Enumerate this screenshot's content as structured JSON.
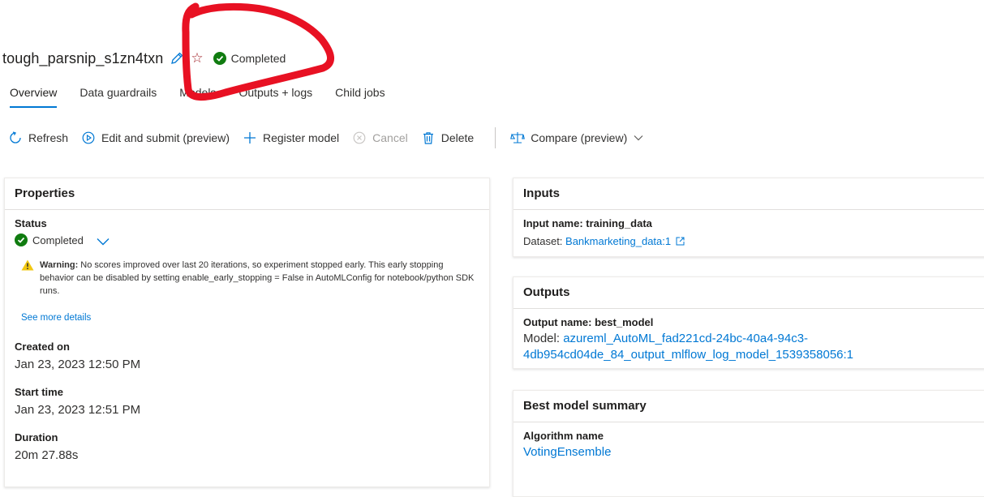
{
  "header": {
    "job_title": "tough_parsnip_s1zn4txn",
    "status": "Completed"
  },
  "tabs": [
    {
      "label": "Overview",
      "active": true
    },
    {
      "label": "Data guardrails"
    },
    {
      "label": "Models"
    },
    {
      "label": "Outputs + logs"
    },
    {
      "label": "Child jobs"
    }
  ],
  "toolbar": {
    "refresh": "Refresh",
    "edit_submit": "Edit and submit (preview)",
    "register_model": "Register model",
    "cancel": "Cancel",
    "delete": "Delete",
    "compare": "Compare (preview)"
  },
  "properties": {
    "title": "Properties",
    "status_label": "Status",
    "status_value": "Completed",
    "warning_bold": "Warning:",
    "warning_text": " No scores improved over last 20 iterations, so experiment stopped early. This early stopping behavior can be disabled by setting enable_early_stopping = False in AutoMLConfig for notebook/python SDK runs.",
    "see_more": "See more details",
    "created_label": "Created on",
    "created_value": "Jan 23, 2023 12:50 PM",
    "start_label": "Start time",
    "start_value": "Jan 23, 2023 12:51 PM",
    "duration_label": "Duration",
    "duration_value": "20m 27.88s"
  },
  "inputs": {
    "title": "Inputs",
    "input_name": "Input name: training_data",
    "dataset_prefix": "Dataset: ",
    "dataset_link": "Bankmarketing_data:1"
  },
  "outputs": {
    "title": "Outputs",
    "output_name": "Output name: best_model",
    "model_prefix": "Model: ",
    "model_link_1": "azureml_AutoML_fad221cd-24bc-40a4-94c3-",
    "model_link_2": "4db954cd04de_84_output_mlflow_log_model_1539358056:1"
  },
  "summary": {
    "title": "Best model summary",
    "algo_label": "Algorithm name",
    "algo_value": "VotingEnsemble"
  },
  "colors": {
    "accent": "#0078d4",
    "success": "#107c10",
    "warning": "#f2c811",
    "annotation": "#e81123"
  }
}
